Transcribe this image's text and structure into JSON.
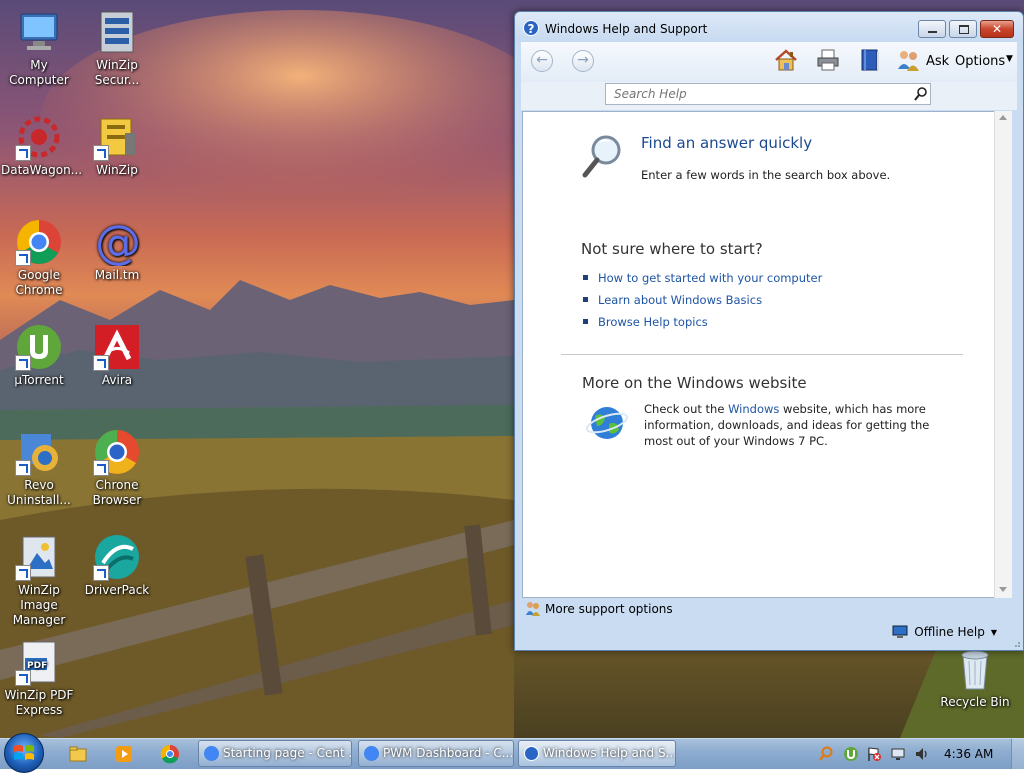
{
  "desktop": {
    "icons": [
      {
        "label": "My Computer",
        "name": "my-computer-icon"
      },
      {
        "label": "WinZip Secur...",
        "name": "winzip-secure-icon"
      },
      {
        "label": "DataWagon...",
        "name": "datawagon-icon"
      },
      {
        "label": "WinZip",
        "name": "winzip-icon"
      },
      {
        "label": "Google Chrome",
        "name": "google-chrome-icon"
      },
      {
        "label": "Mail.tm",
        "name": "mailtm-icon"
      },
      {
        "label": "µTorrent",
        "name": "utorrent-icon"
      },
      {
        "label": "Avira",
        "name": "avira-icon"
      },
      {
        "label": "Revo Uninstall...",
        "name": "revo-uninstaller-icon"
      },
      {
        "label": "Chrone Browser",
        "name": "chrone-browser-icon"
      },
      {
        "label": "WinZip Image Manager",
        "name": "winzip-image-manager-icon"
      },
      {
        "label": "DriverPack",
        "name": "driverpack-icon"
      },
      {
        "label": "WinZip PDF Express",
        "name": "winzip-pdf-express-icon"
      },
      {
        "label": "Recycle Bin",
        "name": "recycle-bin-icon"
      }
    ]
  },
  "help_window": {
    "title": "Windows Help and Support",
    "toolbar": {
      "ask_label": "Ask",
      "options_label": "Options"
    },
    "search": {
      "placeholder": "Search Help"
    },
    "content": {
      "find_heading": "Find an answer quickly",
      "find_sub": "Enter a few words in the search box above.",
      "start_heading": "Not sure where to start?",
      "links": [
        "How to get started with your computer",
        "Learn about Windows Basics",
        "Browse Help topics"
      ],
      "web_heading": "More on the Windows website",
      "web_text_before": "Check out the ",
      "web_link": "Windows",
      "web_text_after": " website, which has more information, downloads, and ideas for getting the most out of your Windows 7 PC."
    },
    "support_label": "More support options",
    "offline_label": "Offline Help"
  },
  "taskbar": {
    "tasks": [
      {
        "label": "Starting page - Cent ..."
      },
      {
        "label": "PWM Dashboard - C..."
      },
      {
        "label": "Windows Help and S..."
      }
    ],
    "clock": "4:36 AM"
  },
  "colors": {
    "link": "#1f55a5",
    "heading_blue": "#1c4a91",
    "taskbar": "#8fadd0"
  }
}
